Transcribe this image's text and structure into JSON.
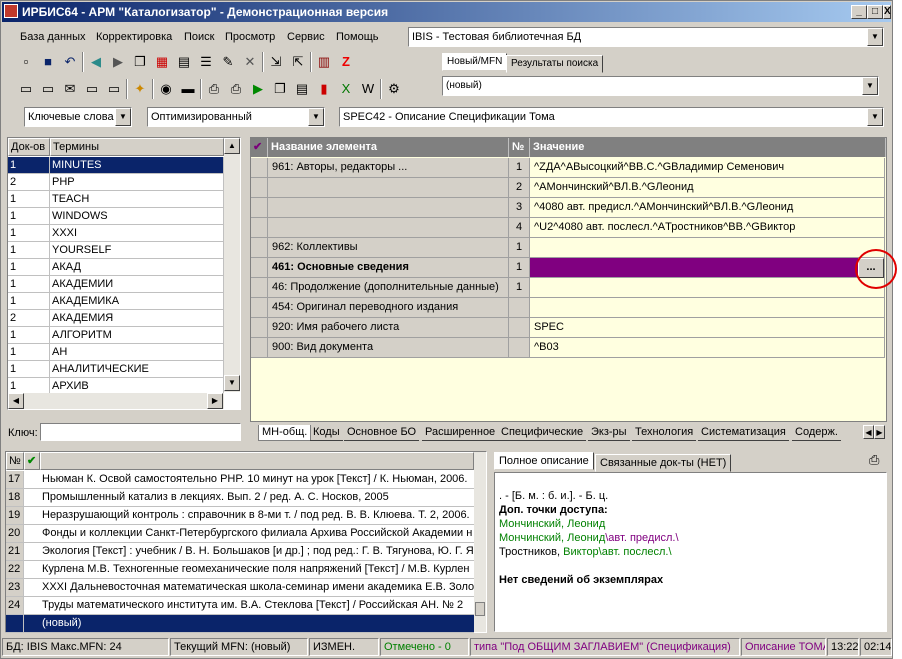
{
  "window": {
    "title": "ИРБИС64 - АРМ \"Каталогизатор\" - Демонстрационная версия",
    "min": "_",
    "max": "□",
    "close": "X"
  },
  "menu": [
    "База данных",
    "Корректировка",
    "Поиск",
    "Просмотр",
    "Сервис",
    "Помощь"
  ],
  "db_combo": "IBIS - Тестовая библиотечная БД",
  "tabs_top": [
    "Новый/MFN",
    "Результаты поиска"
  ],
  "mfn_combo": "(новый)",
  "search": {
    "mode": "Ключевые слова",
    "optimize": "Оптимизированный",
    "worksheet": "SPEC42 - Описание Спецификации Тома"
  },
  "terms": {
    "headers": [
      "Док-ов",
      "Термины"
    ],
    "rows": [
      [
        "1",
        "MINUTES"
      ],
      [
        "2",
        "PHP"
      ],
      [
        "1",
        "TEACH"
      ],
      [
        "1",
        "WINDOWS"
      ],
      [
        "1",
        "XXXI"
      ],
      [
        "1",
        "YOURSELF"
      ],
      [
        "1",
        "АКАД"
      ],
      [
        "1",
        "АКАДЕМИИ"
      ],
      [
        "1",
        "АКАДЕМИКА"
      ],
      [
        "2",
        "АКАДЕМИЯ"
      ],
      [
        "1",
        "АЛГОРИТМ"
      ],
      [
        "1",
        "АН"
      ],
      [
        "1",
        "АНАЛИТИЧЕСКИЕ"
      ],
      [
        "1",
        "АРХИВ"
      ]
    ],
    "key_label": "Ключ:",
    "key_value": ""
  },
  "grid": {
    "headers": [
      "Название элемента",
      "№",
      "Значение"
    ],
    "check": "✔",
    "rows": [
      [
        "961: Авторы, редакторы ...",
        "1",
        "^ZДА^AВысоцкий^BB.C.^GВладимир Семенович"
      ],
      [
        "",
        "2",
        "^AМончинский^BЛ.В.^GЛеонид"
      ],
      [
        "",
        "3",
        "^4080 авт. предисл.^AМончинский^BЛ.В.^GЛеонид"
      ],
      [
        "",
        "4",
        "^U2^4080 авт. послесл.^AТростников^BB.^GВиктор"
      ],
      [
        "962: Коллективы",
        "1",
        ""
      ],
      [
        "461: Основные сведения",
        "1",
        ""
      ],
      [
        "46: Продолжение (дополнительные данные)",
        "1",
        ""
      ],
      [
        "454: Оригинал переводного издания",
        "",
        ""
      ],
      [
        "920: Имя рабочего листа",
        "",
        "SPEC"
      ],
      [
        "900: Вид документа",
        "",
        "^B03"
      ]
    ],
    "ellipsis": "..."
  },
  "bottom_tabs": [
    "МН-общ.",
    "Коды",
    "Основное БО",
    "Расширенное",
    "Специфические",
    "Экз-ры",
    "Технология",
    "Систематизация",
    "Содерж."
  ],
  "list": {
    "headers": [
      "№",
      "✔"
    ],
    "rows": [
      [
        "17",
        "Ньюман К. Освой самостоятельно PHP. 10 минут на урок [Текст] / К. Ньюман, 2006."
      ],
      [
        "18",
        "Промышленный катализ в лекциях. Вып. 2 / ред. А. С. Носков, 2005"
      ],
      [
        "19",
        "Неразрушающий контроль : справочник в 8-ми т. / под ред. В. В. Клюева. Т. 2, 2006."
      ],
      [
        "20",
        "Фонды и коллекции Санкт-Петербургского филиала Архива Российской Академии н"
      ],
      [
        "21",
        "Экология [Текст] : учебник / В. Н. Большаков [и др.] ; под ред.: Г. В. Тягунова, Ю. Г. Я"
      ],
      [
        "22",
        "Курлена М.В. Техногенные геомеханические поля напряжений [Текст] / М.В. Курлен"
      ],
      [
        "23",
        "XXXI Дальневосточная математическая школа-семинар имени академика Е.В. Золо"
      ],
      [
        "24",
        "Труды математического института им. В.А. Стеклова [Текст] / Российская АН. № 2"
      ],
      [
        "",
        "(новый)"
      ]
    ]
  },
  "desc_tabs": [
    "Полное описание",
    "Связанные док-ты (НЕТ)"
  ],
  "desc": {
    "l1": ". - [Б. м. : б. и.]. - Б. ц.",
    "l2": "Доп. точки доступа:",
    "l3": "Мончинский, Леонид",
    "l4a": "Мончинский, Леонид",
    "l4b": "\\авт. предисл.\\",
    "l5a": "Тростников, ",
    "l5b": "Виктор\\авт. послесл.\\",
    "l6": "Нет сведений об экземплярах"
  },
  "status": {
    "db": "БД: IBIS Макс.MFN: 24",
    "mfn": "Текущий MFN: (новый)",
    "changed": "ИЗМЕН.",
    "marked": "Отмечено - 0",
    "type": "типа \"Под ОБЩИМ ЗАГЛАВИЕМ\" (Спецификация)",
    "desc": "Описание ТОМА",
    "time": "13:22",
    "time2": "02:14"
  },
  "colors": {
    "accent": "#800080",
    "selection": "#0a246a",
    "highlight_circle": "#e00000"
  }
}
